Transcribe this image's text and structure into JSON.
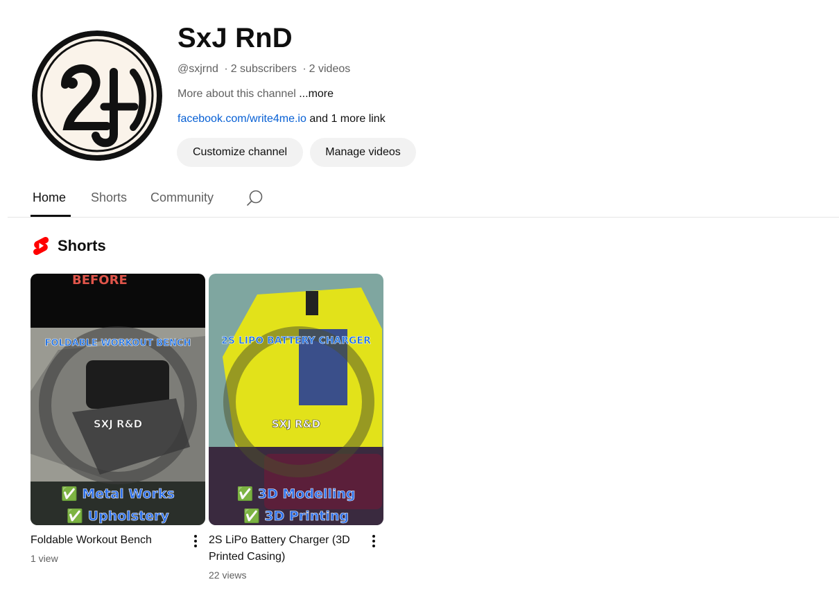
{
  "channel": {
    "name": "SxJ RnD",
    "handle": "@sxjrnd",
    "subscribers": "2 subscribers",
    "videos": "2 videos",
    "separator": "·",
    "description": "More about this channel",
    "more_label": "...more",
    "link_text": "facebook.com/write4me.io",
    "more_links": "and 1 more link",
    "avatar_icon": "sxj-logo-icon"
  },
  "buttons": {
    "customize": "Customize channel",
    "manage": "Manage videos"
  },
  "tabs": [
    {
      "label": "Home",
      "active": true
    },
    {
      "label": "Shorts",
      "active": false
    },
    {
      "label": "Community",
      "active": false
    }
  ],
  "search_icon": "search-icon",
  "shorts_section": {
    "title": "Shorts",
    "icon": "shorts-icon",
    "icon_color": "#ff0000",
    "items": [
      {
        "title": "Foldable Workout Bench",
        "views": "1 view",
        "overlay_top": "BEFORE",
        "overlay_banner": "FOLDABLE WORKOUT BENCH",
        "watermark": "SXJ R&D",
        "overlay_line1": "✅ Metal Works",
        "overlay_line2": "✅ Upholstery"
      },
      {
        "title": "2S LiPo Battery Charger (3D Printed Casing)",
        "views": "22 views",
        "overlay_banner": "2S LIPO BATTERY CHARGER",
        "watermark": "SXJ R&D",
        "overlay_line1": "✅ 3D Modelling",
        "overlay_line2": "✅ 3D Printing"
      }
    ]
  }
}
